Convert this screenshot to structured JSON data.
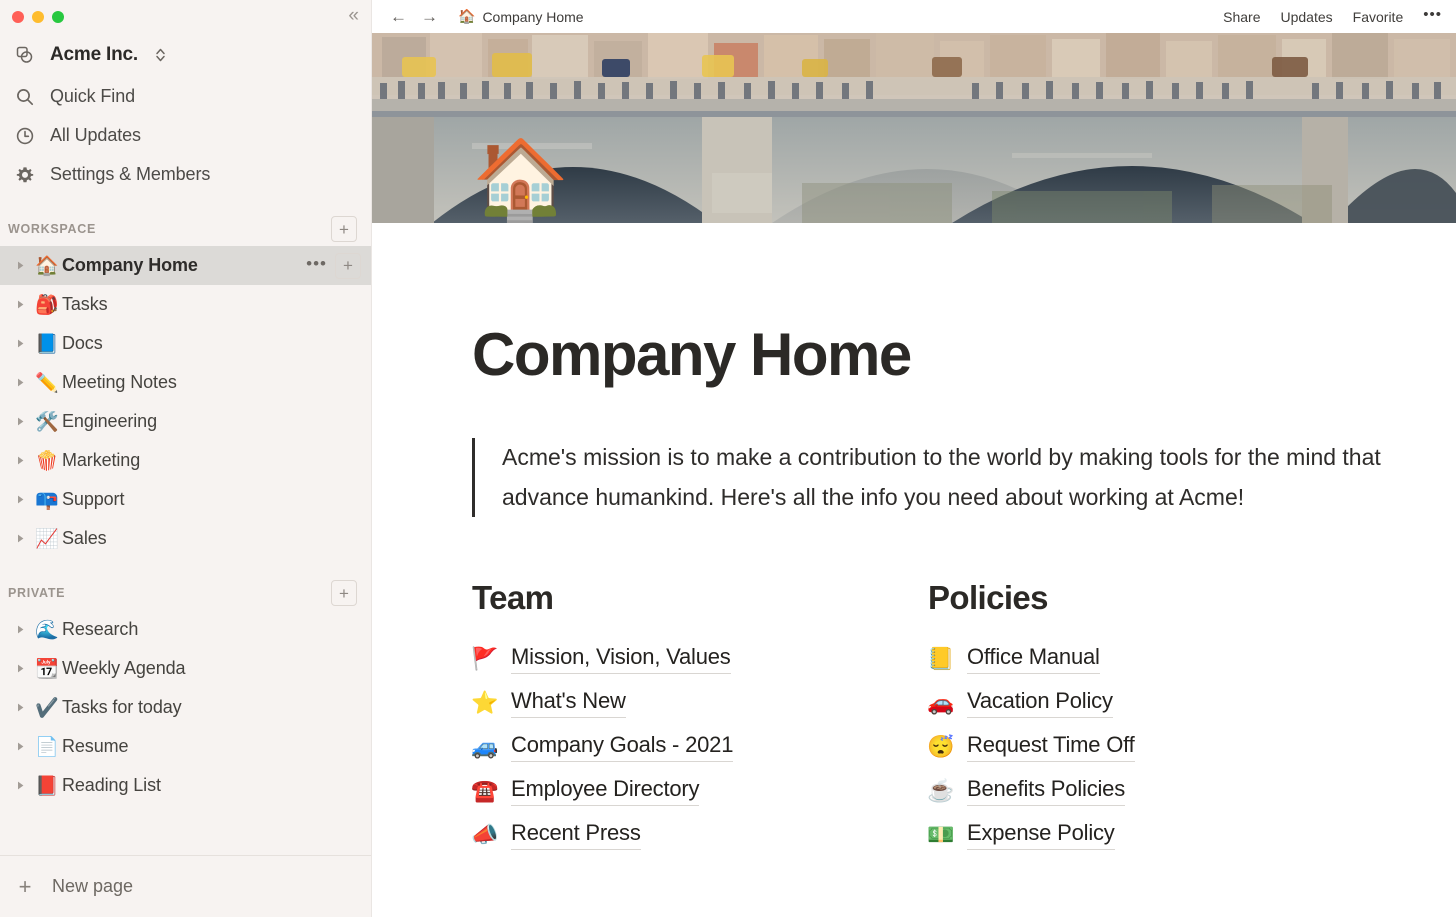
{
  "window": {
    "traffic_lights": [
      "close",
      "minimize",
      "maximize"
    ],
    "collapse_label": "«",
    "colors": {
      "sidebar_bg": "#f7f3f1",
      "selected_row": "#dcdad7",
      "accent_text": "#2b2926"
    }
  },
  "sidebar": {
    "workspace_switcher": {
      "name": "Acme Inc."
    },
    "nav": [
      {
        "label": "Quick Find",
        "icon": "search-icon"
      },
      {
        "label": "All Updates",
        "icon": "clock-icon"
      },
      {
        "label": "Settings & Members",
        "icon": "gear-icon"
      }
    ],
    "workspace_section": {
      "title": "WORKSPACE",
      "add_label": "+",
      "pages": [
        {
          "label": "Company Home",
          "emoji": "🏠",
          "selected": true
        },
        {
          "label": "Tasks",
          "emoji": "🎒",
          "selected": false
        },
        {
          "label": "Docs",
          "emoji": "📘",
          "selected": false
        },
        {
          "label": "Meeting Notes",
          "emoji": "✏️",
          "selected": false
        },
        {
          "label": "Engineering",
          "emoji": "🛠️",
          "selected": false
        },
        {
          "label": "Marketing",
          "emoji": "🍿",
          "selected": false
        },
        {
          "label": "Support",
          "emoji": "📪",
          "selected": false
        },
        {
          "label": "Sales",
          "emoji": "📈",
          "selected": false
        }
      ]
    },
    "private_section": {
      "title": "PRIVATE",
      "add_label": "+",
      "pages": [
        {
          "label": "Research",
          "emoji": "🌊"
        },
        {
          "label": "Weekly Agenda",
          "emoji": "📆"
        },
        {
          "label": "Tasks for today",
          "emoji": "✔️"
        },
        {
          "label": "Resume",
          "emoji": "📄"
        },
        {
          "label": "Reading List",
          "emoji": "📕"
        }
      ]
    },
    "row_actions": {
      "more_label": "•••",
      "add_label": "+"
    },
    "footer": {
      "label": "New page",
      "icon_label": "+"
    }
  },
  "topbar": {
    "back_label": "←",
    "forward_label": "→",
    "breadcrumb": {
      "emoji": "🏠",
      "label": "Company Home"
    },
    "actions": [
      "Share",
      "Updates",
      "Favorite"
    ],
    "more_label": "•••"
  },
  "page": {
    "emoji": "🏠",
    "title": "Company Home",
    "quote": "Acme's mission is to make a contribution to the world by making tools for the mind that advance humankind. Here's all the info you need about working at Acme!",
    "columns": [
      {
        "title": "Team",
        "links": [
          {
            "label": "Mission, Vision, Values",
            "emoji": "🚩"
          },
          {
            "label": "What's New",
            "emoji": "⭐"
          },
          {
            "label": "Company Goals - 2021",
            "emoji": "🚙"
          },
          {
            "label": "Employee Directory",
            "emoji": "☎️"
          },
          {
            "label": "Recent Press",
            "emoji": "📣"
          }
        ]
      },
      {
        "title": "Policies",
        "links": [
          {
            "label": "Office Manual",
            "emoji": "📒"
          },
          {
            "label": "Vacation Policy",
            "emoji": "🚗"
          },
          {
            "label": "Request Time Off",
            "emoji": "😴"
          },
          {
            "label": "Benefits Policies",
            "emoji": "☕"
          },
          {
            "label": "Expense Policy",
            "emoji": "💵"
          }
        ]
      }
    ]
  }
}
